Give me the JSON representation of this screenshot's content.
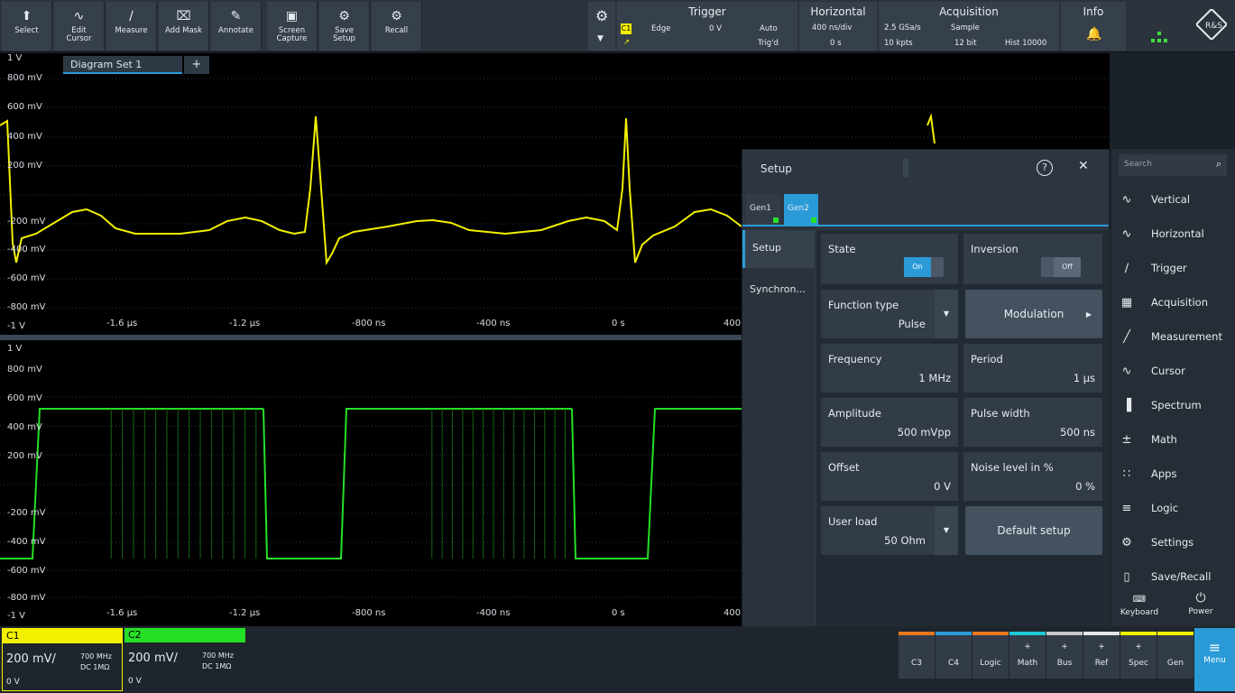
{
  "toolbar": {
    "tools": [
      {
        "label": "Select",
        "icon": "cursor-arrow-icon"
      },
      {
        "label": "Edit\nCursor",
        "icon": "cursor-wave-icon"
      },
      {
        "label": "Measure",
        "icon": "ruler-icon"
      },
      {
        "label": "Add Mask",
        "icon": "mask-icon"
      },
      {
        "label": "Annotate",
        "icon": "pencil-icon"
      },
      {
        "label": "Screen\nCapture",
        "icon": "camera-icon"
      },
      {
        "label": "Save\nSetup",
        "icon": "save-setup-icon"
      },
      {
        "label": "Recall",
        "icon": "recall-icon"
      }
    ],
    "trigger": {
      "title": "Trigger",
      "source": "C1",
      "type": "Edge",
      "level": "0 V",
      "mode": "Auto",
      "mode2": "Trig'd"
    },
    "horizontal": {
      "title": "Horizontal",
      "scale": "400 ns/div",
      "position": "0 s"
    },
    "acquisition": {
      "title": "Acquisition",
      "rate": "2.5 GSa/s",
      "mode": "Sample",
      "points": "10 kpts",
      "bits": "12 bit",
      "hist": "Hist 10000"
    },
    "info": {
      "title": "Info"
    }
  },
  "diagram": {
    "tab_label": "Diagram Set 1",
    "tab_add": "+",
    "upper_y_labels": [
      "1 V",
      "800 mV",
      "600 mV",
      "400 mV",
      "200 mV",
      "-200 mV",
      "-400 mV",
      "-600 mV",
      "-800 mV",
      "-1 V"
    ],
    "lower_y_labels": [
      "1 V",
      "800 mV",
      "600 mV",
      "400 mV",
      "200 mV",
      "-200 mV",
      "-400 mV",
      "-600 mV",
      "-800 mV",
      "-1 V"
    ],
    "x_labels": [
      "-1.6 µs",
      "-1.2 µs",
      "-800 ns",
      "-400 ns",
      "0 s",
      "400"
    ]
  },
  "dialog": {
    "title": "Setup",
    "tabs": [
      "Gen1",
      "Gen2"
    ],
    "side_items": [
      "Setup",
      "Synchron..."
    ],
    "state": {
      "label": "State",
      "value": "On"
    },
    "inversion": {
      "label": "Inversion",
      "value": "Off"
    },
    "function_type": {
      "label": "Function type",
      "value": "Pulse"
    },
    "modulation": {
      "label": "Modulation"
    },
    "frequency": {
      "label": "Frequency",
      "value": "1 MHz"
    },
    "period": {
      "label": "Period",
      "value": "1 µs"
    },
    "amplitude": {
      "label": "Amplitude",
      "value": "500 mVpp"
    },
    "pulse_width": {
      "label": "Pulse width",
      "value": "500 ns"
    },
    "offset": {
      "label": "Offset",
      "value": "0 V"
    },
    "noise": {
      "label": "Noise level in %",
      "value": "0 %"
    },
    "user_load": {
      "label": "User load",
      "value": "50 Ohm"
    },
    "default_setup": {
      "label": "Default setup"
    }
  },
  "menu": {
    "search_placeholder": "Search",
    "items": [
      {
        "label": "Vertical",
        "icon": "vertical-icon"
      },
      {
        "label": "Horizontal",
        "icon": "horizontal-icon"
      },
      {
        "label": "Trigger",
        "icon": "trigger-icon"
      },
      {
        "label": "Acquisition",
        "icon": "acquisition-icon"
      },
      {
        "label": "Measurement",
        "icon": "measurement-icon"
      },
      {
        "label": "Cursor",
        "icon": "cursor-icon"
      },
      {
        "label": "Spectrum",
        "icon": "spectrum-icon"
      },
      {
        "label": "Math",
        "icon": "math-icon"
      },
      {
        "label": "Apps",
        "icon": "apps-icon"
      },
      {
        "label": "Logic",
        "icon": "logic-icon"
      },
      {
        "label": "Settings",
        "icon": "settings-icon"
      },
      {
        "label": "Save/Recall",
        "icon": "save-recall-icon"
      }
    ],
    "keyboard": "Keyboard",
    "power": "Power"
  },
  "channels": [
    {
      "name": "C1",
      "scale": "200 mV/",
      "bw": "700 MHz",
      "coupling": "DC 1MΩ",
      "offset": "0 V",
      "color": "#f3f000"
    },
    {
      "name": "C2",
      "scale": "200 mV/",
      "bw": "700 MHz",
      "coupling": "DC 1MΩ",
      "offset": "0 V",
      "color": "#25e025"
    }
  ],
  "bottom_buttons": [
    {
      "label": "C3",
      "plus": "",
      "color": "#e8781e"
    },
    {
      "label": "C4",
      "plus": "",
      "color": "#2b9bd8"
    },
    {
      "label": "Logic",
      "plus": "",
      "color": "#e8781e"
    },
    {
      "label": "Math",
      "plus": "+",
      "color": "#1ec8d8"
    },
    {
      "label": "Bus",
      "plus": "+",
      "color": "#c8c8c8"
    },
    {
      "label": "Ref",
      "plus": "+",
      "color": "#e6e6e6"
    },
    {
      "label": "Spec",
      "plus": "+",
      "color": "#f3f000"
    },
    {
      "label": "Gen",
      "plus": "",
      "color": "#f3f000"
    }
  ],
  "menu_button": "Menu"
}
